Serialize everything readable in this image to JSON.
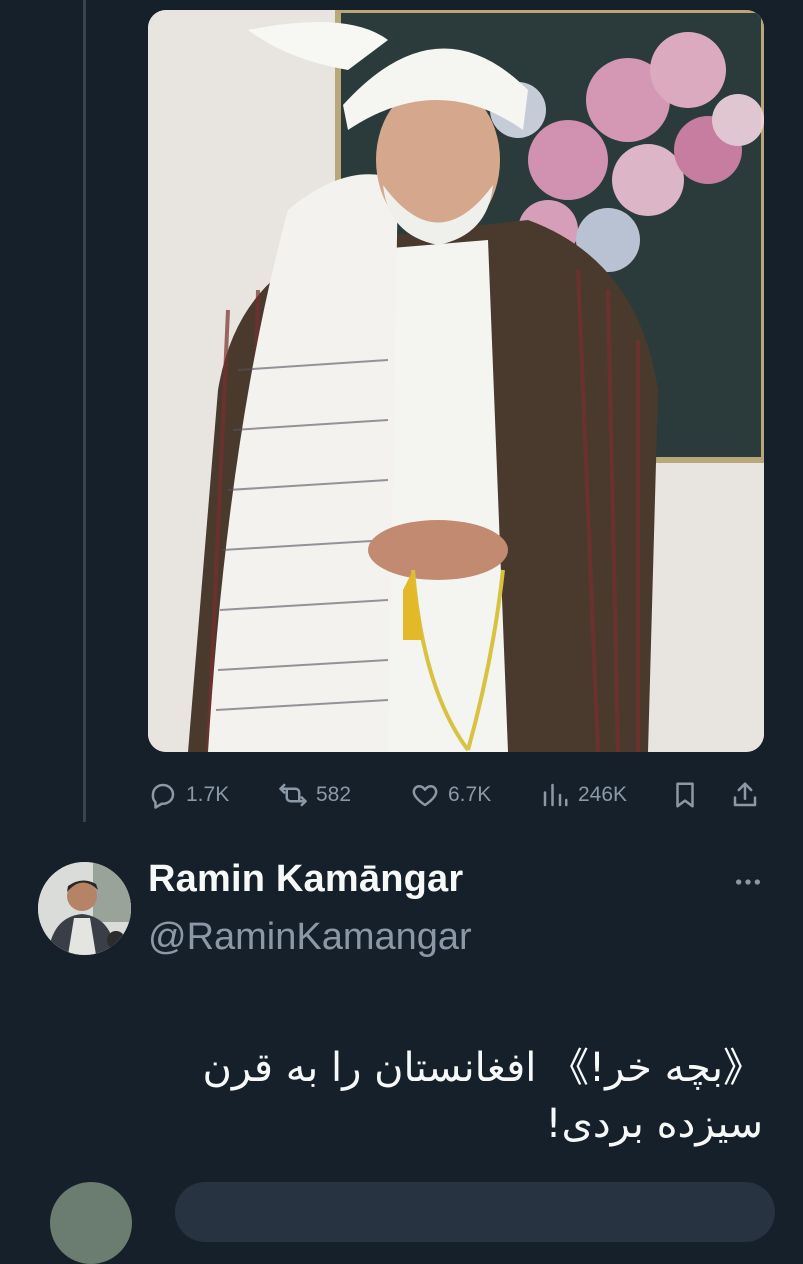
{
  "tweet": {
    "media_description_icon": "photo",
    "actions": {
      "reply_count": "1.7K",
      "retweet_count": "582",
      "like_count": "6.7K",
      "view_count": "246K"
    }
  },
  "reply": {
    "display_name": "Ramin Kamāngar",
    "handle": "@RaminKamangar",
    "text": "《بچه خر!》 افغانستان را به قرن سیزده بردی!"
  },
  "icons": {
    "reply": "reply-icon",
    "retweet": "retweet-icon",
    "like": "heart-icon",
    "views": "views-icon",
    "bookmark": "bookmark-icon",
    "share": "share-icon",
    "more": "more-icon"
  },
  "colors": {
    "background": "#15202b",
    "muted_text": "#8b98a5",
    "primary_text": "#f7f9f9",
    "thread_line": "#38444d"
  }
}
